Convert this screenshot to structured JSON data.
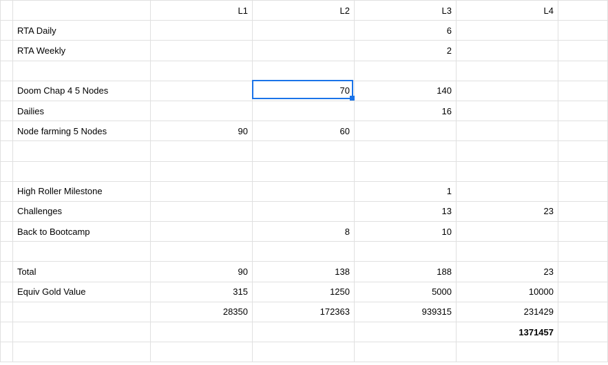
{
  "headers": {
    "c1": "L1",
    "c2": "L2",
    "c3": "L3",
    "c4": "L4"
  },
  "rows": {
    "rta_daily": {
      "label": "RTA Daily",
      "c1": "",
      "c2": "",
      "c3": "6",
      "c4": ""
    },
    "rta_weekly": {
      "label": "RTA Weekly",
      "c1": "",
      "c2": "",
      "c3": "2",
      "c4": ""
    },
    "blank1": {
      "label": "",
      "c1": "",
      "c2": "",
      "c3": "",
      "c4": ""
    },
    "doom": {
      "label": "Doom Chap 4 5 Nodes",
      "c1": "",
      "c2": "70",
      "c3": "140",
      "c4": ""
    },
    "dailies": {
      "label": "Dailies",
      "c1": "",
      "c2": "",
      "c3": "16",
      "c4": ""
    },
    "nodefarm": {
      "label": "Node farming 5 Nodes",
      "c1": "90",
      "c2": "60",
      "c3": "",
      "c4": ""
    },
    "blank2": {
      "label": "",
      "c1": "",
      "c2": "",
      "c3": "",
      "c4": ""
    },
    "blank3": {
      "label": "",
      "c1": "",
      "c2": "",
      "c3": "",
      "c4": ""
    },
    "highroller": {
      "label": "High Roller Milestone",
      "c1": "",
      "c2": "",
      "c3": "1",
      "c4": ""
    },
    "challenges": {
      "label": "Challenges",
      "c1": "",
      "c2": "",
      "c3": "13",
      "c4": "23"
    },
    "bootcamp": {
      "label": "Back to Bootcamp",
      "c1": "",
      "c2": "8",
      "c3": "10",
      "c4": ""
    },
    "blank4": {
      "label": "",
      "c1": "",
      "c2": "",
      "c3": "",
      "c4": ""
    },
    "total": {
      "label": "Total",
      "c1": "90",
      "c2": "138",
      "c3": "188",
      "c4": "23"
    },
    "equiv": {
      "label": "Equiv Gold Value",
      "c1": "315",
      "c2": "1250",
      "c3": "5000",
      "c4": "10000"
    },
    "prod": {
      "label": "",
      "c1": "28350",
      "c2": "172363",
      "c3": "939315",
      "c4": "231429"
    },
    "grand": {
      "label": "",
      "c1": "",
      "c2": "",
      "c3": "",
      "c4": "1371457"
    },
    "blank5": {
      "label": "",
      "c1": "",
      "c2": "",
      "c3": "",
      "c4": ""
    }
  },
  "selection": {
    "row": "doom",
    "col": "c2"
  }
}
